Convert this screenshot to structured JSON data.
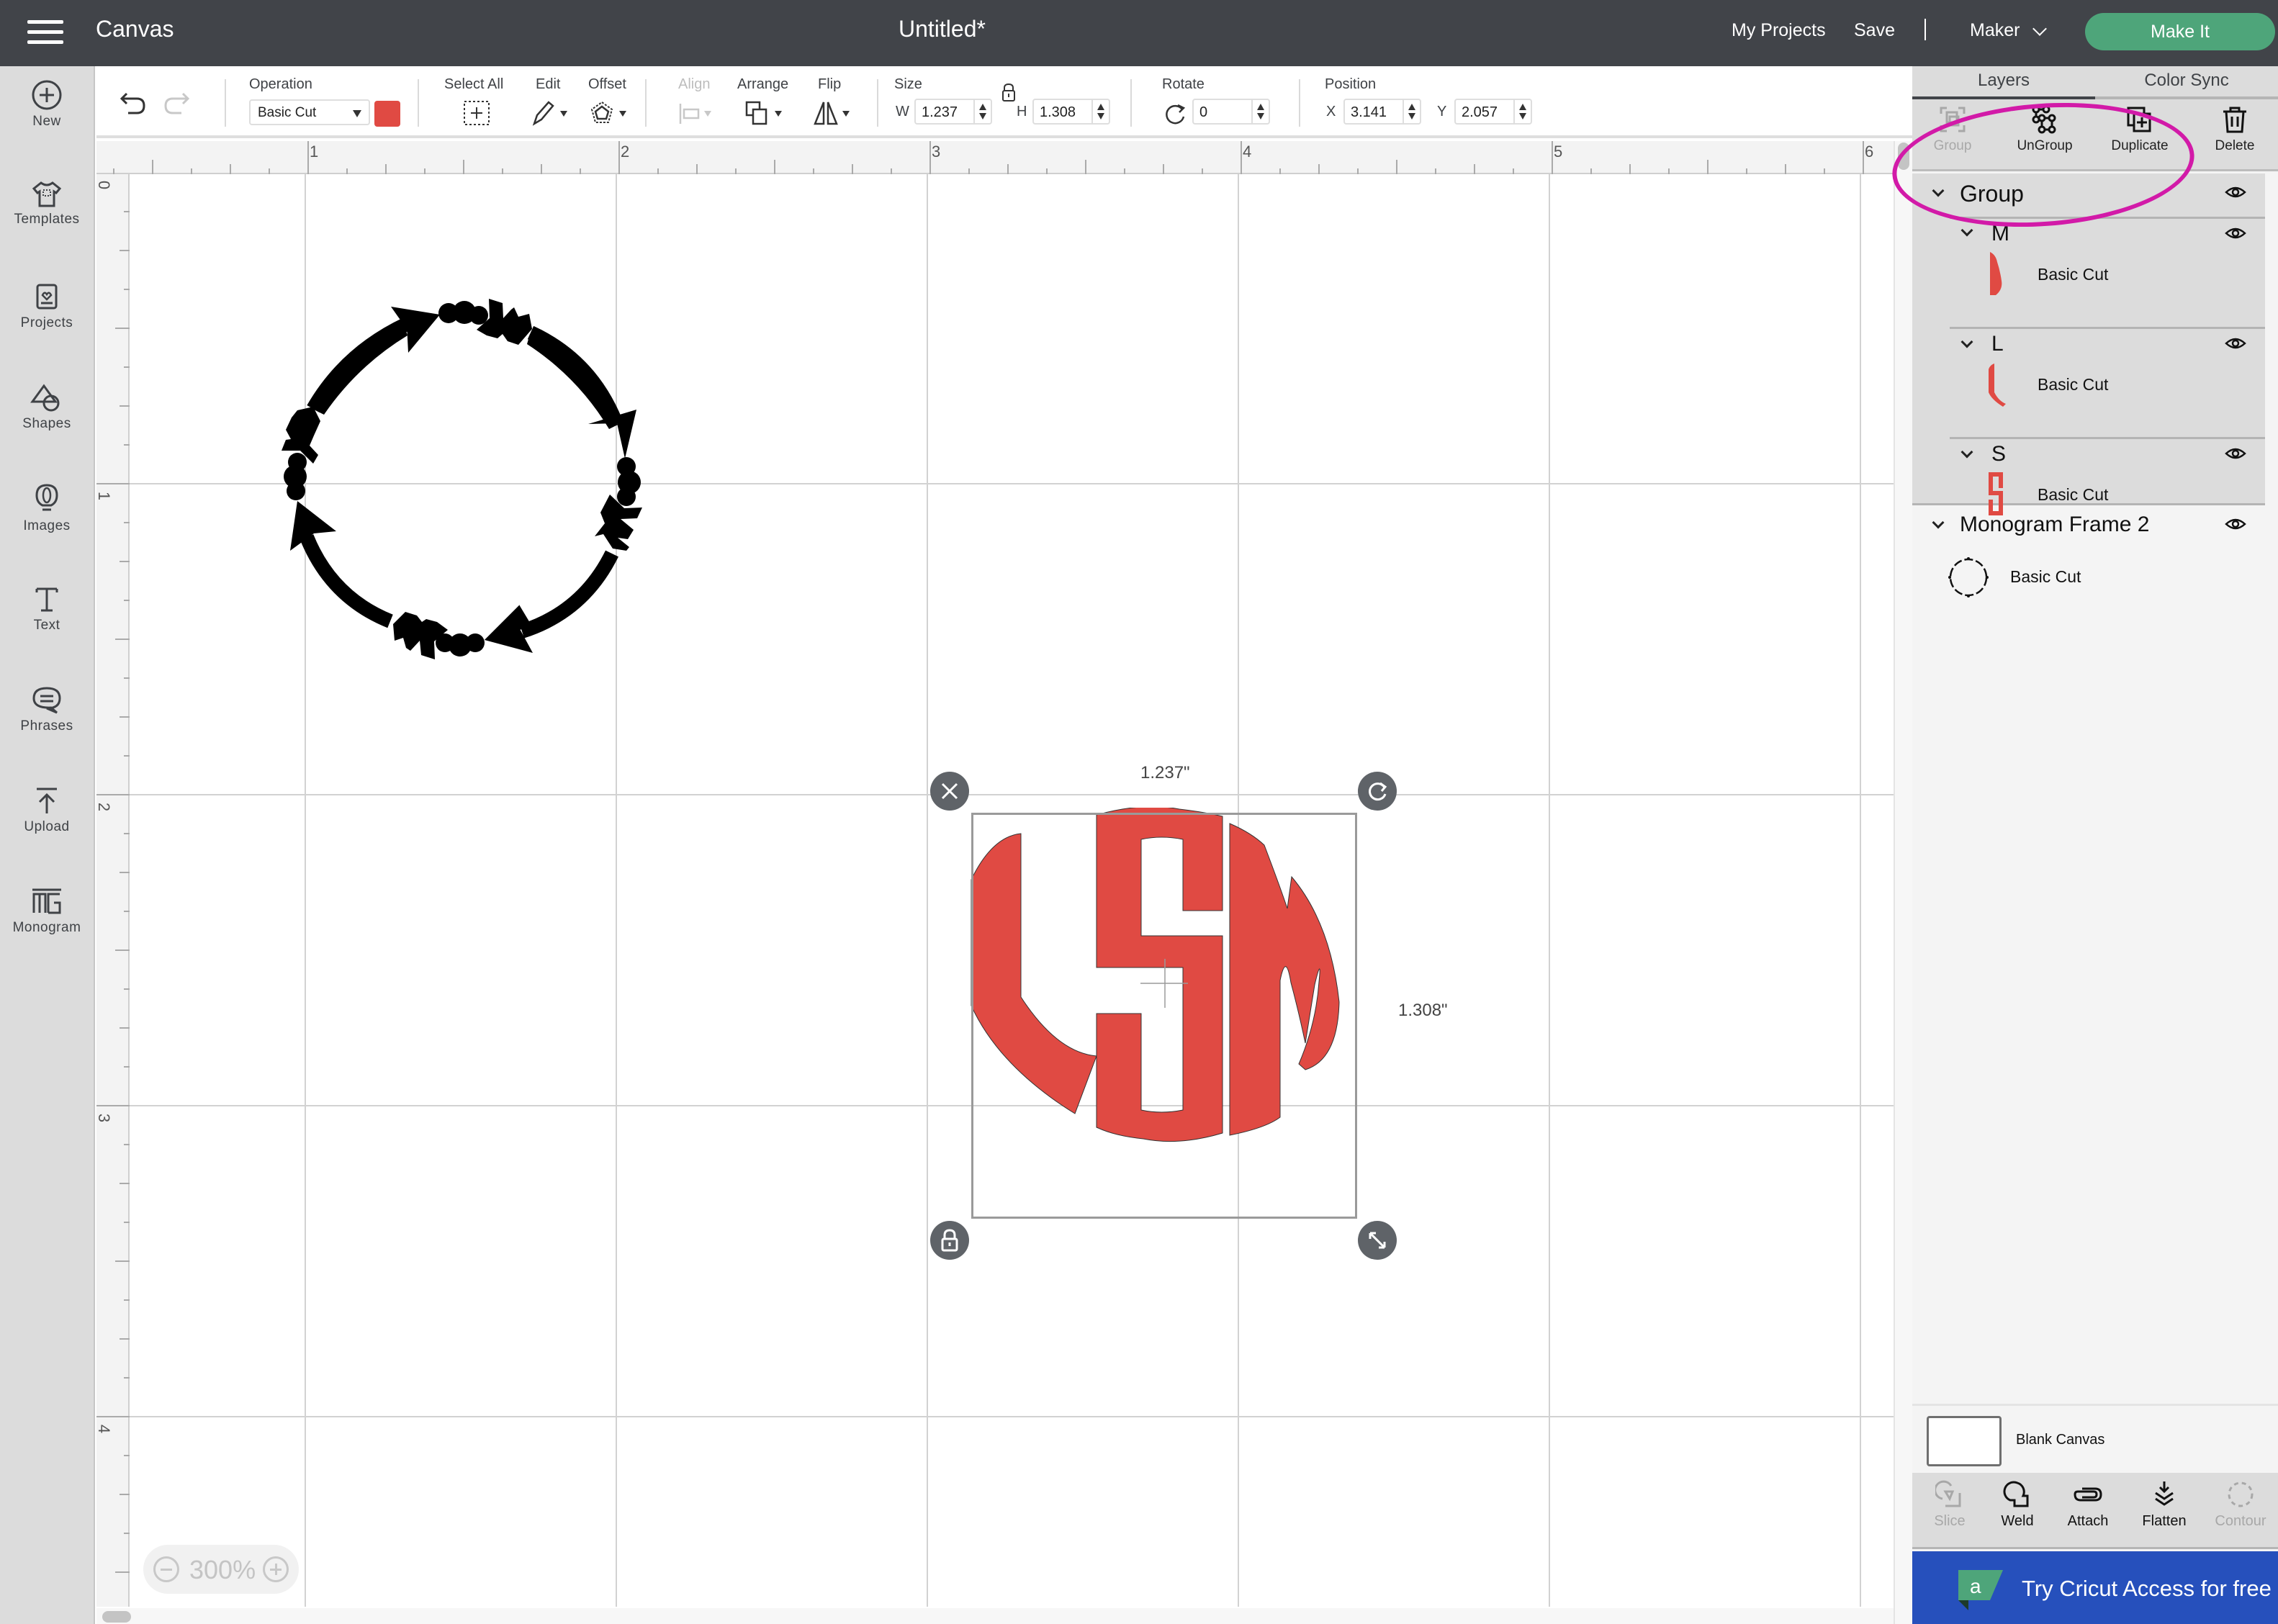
{
  "topbar": {
    "menu_icon": "hamburger-icon",
    "app_title": "Canvas",
    "doc_title": "Untitled*",
    "my_projects": "My Projects",
    "save": "Save",
    "separator": "|",
    "machine": "Maker",
    "make_it": "Make It"
  },
  "sidebar": {
    "items": [
      {
        "label": "New",
        "icon": "plus-circle-icon"
      },
      {
        "label": "Templates",
        "icon": "shirt-icon"
      },
      {
        "label": "Projects",
        "icon": "projects-icon"
      },
      {
        "label": "Shapes",
        "icon": "shapes-icon"
      },
      {
        "label": "Images",
        "icon": "lightbulb-icon"
      },
      {
        "label": "Text",
        "icon": "text-icon"
      },
      {
        "label": "Phrases",
        "icon": "speech-bubble-icon"
      },
      {
        "label": "Upload",
        "icon": "upload-icon"
      },
      {
        "label": "Monogram",
        "icon": "monogram-icon"
      }
    ]
  },
  "toolbar": {
    "undo_icon": "undo-icon",
    "redo_icon": "redo-icon",
    "operation_label": "Operation",
    "operation_value": "Basic Cut",
    "operation_color": "#e04a43",
    "select_all": "Select All",
    "edit": "Edit",
    "offset": "Offset",
    "align": "Align",
    "arrange": "Arrange",
    "flip": "Flip",
    "size_label": "Size",
    "w_label": "W",
    "w_value": "1.237",
    "h_label": "H",
    "h_value": "1.308",
    "rotate_label": "Rotate",
    "rotate_value": "0",
    "position_label": "Position",
    "x_label": "X",
    "x_value": "3.141",
    "y_label": "Y",
    "y_value": "2.057"
  },
  "rulers": {
    "top": [
      "1",
      "2",
      "3",
      "4",
      "5",
      "6"
    ],
    "left": [
      "0",
      "1",
      "2",
      "3",
      "4"
    ]
  },
  "canvas": {
    "zoom_level": "300%",
    "selection_width_label": "1.237\"",
    "selection_height_label": "1.308\"",
    "monogram_letters": "LSM",
    "monogram_color": "#e04a43",
    "frame_color": "#000000"
  },
  "right_panel": {
    "tabs": [
      {
        "label": "Layers",
        "active": true
      },
      {
        "label": "Color Sync",
        "active": false
      }
    ],
    "actions": [
      {
        "label": "Group",
        "enabled": false,
        "icon": "group-icon"
      },
      {
        "label": "UnGroup",
        "enabled": true,
        "icon": "ungroup-icon"
      },
      {
        "label": "Duplicate",
        "enabled": true,
        "icon": "duplicate-icon"
      },
      {
        "label": "Delete",
        "enabled": true,
        "icon": "trash-icon"
      }
    ],
    "layers": {
      "group_name": "Group",
      "children": [
        {
          "name": "M",
          "operation": "Basic Cut"
        },
        {
          "name": "L",
          "operation": "Basic Cut"
        },
        {
          "name": "S",
          "operation": "Basic Cut"
        }
      ],
      "frame_name": "Monogram Frame 2",
      "frame_operation": "Basic Cut"
    },
    "blank_canvas": "Blank Canvas",
    "bottom_actions": [
      {
        "label": "Slice",
        "enabled": false
      },
      {
        "label": "Weld",
        "enabled": true
      },
      {
        "label": "Attach",
        "enabled": true
      },
      {
        "label": "Flatten",
        "enabled": true
      },
      {
        "label": "Contour",
        "enabled": false
      }
    ],
    "access_banner": "Try Cricut Access for free",
    "access_logo_letter": "a"
  },
  "annotation": {
    "color": "#d21aa8",
    "highlights": "Group layer"
  }
}
